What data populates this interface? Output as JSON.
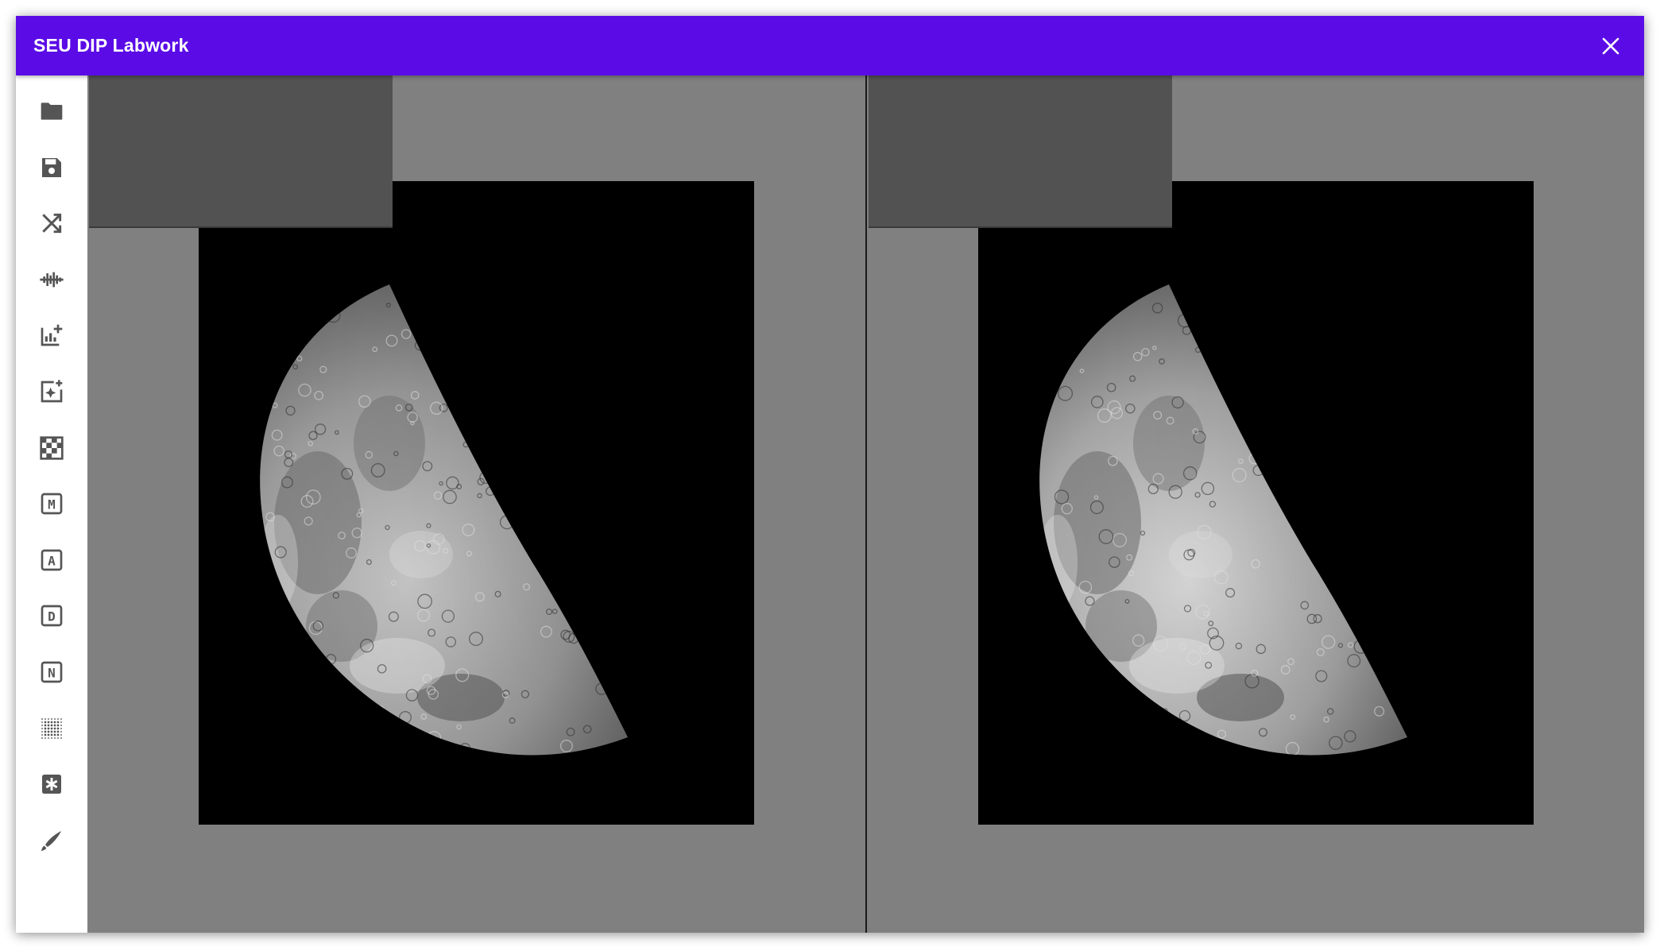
{
  "window": {
    "title": "SEU DIP Labwork",
    "accent_color": "#5b0ce6"
  },
  "toolbar": {
    "items": [
      {
        "icon": "folder-icon",
        "name": "open-image"
      },
      {
        "icon": "save-icon",
        "name": "save-image"
      },
      {
        "icon": "shuffle-icon",
        "name": "shuffle"
      },
      {
        "icon": "waveform-icon",
        "name": "waveform"
      },
      {
        "icon": "histogram-add-icon",
        "name": "histogram"
      },
      {
        "icon": "enhance-icon",
        "name": "enhance"
      },
      {
        "icon": "checkerboard-icon",
        "name": "checkerboard"
      },
      {
        "icon": "letter-m-icon",
        "name": "m-tool",
        "letter": "M"
      },
      {
        "icon": "letter-a-icon",
        "name": "a-tool",
        "letter": "A"
      },
      {
        "icon": "letter-d-icon",
        "name": "d-tool",
        "letter": "D"
      },
      {
        "icon": "letter-n-icon",
        "name": "n-tool",
        "letter": "N"
      },
      {
        "icon": "dot-grid-icon",
        "name": "dot-grid"
      },
      {
        "icon": "asterisk-box-icon",
        "name": "asterisk-tool"
      },
      {
        "icon": "brush-icon",
        "name": "brush"
      }
    ]
  },
  "panes": {
    "left": {
      "subject": "moon-grayscale-original"
    },
    "right": {
      "subject": "moon-grayscale-processed"
    }
  }
}
